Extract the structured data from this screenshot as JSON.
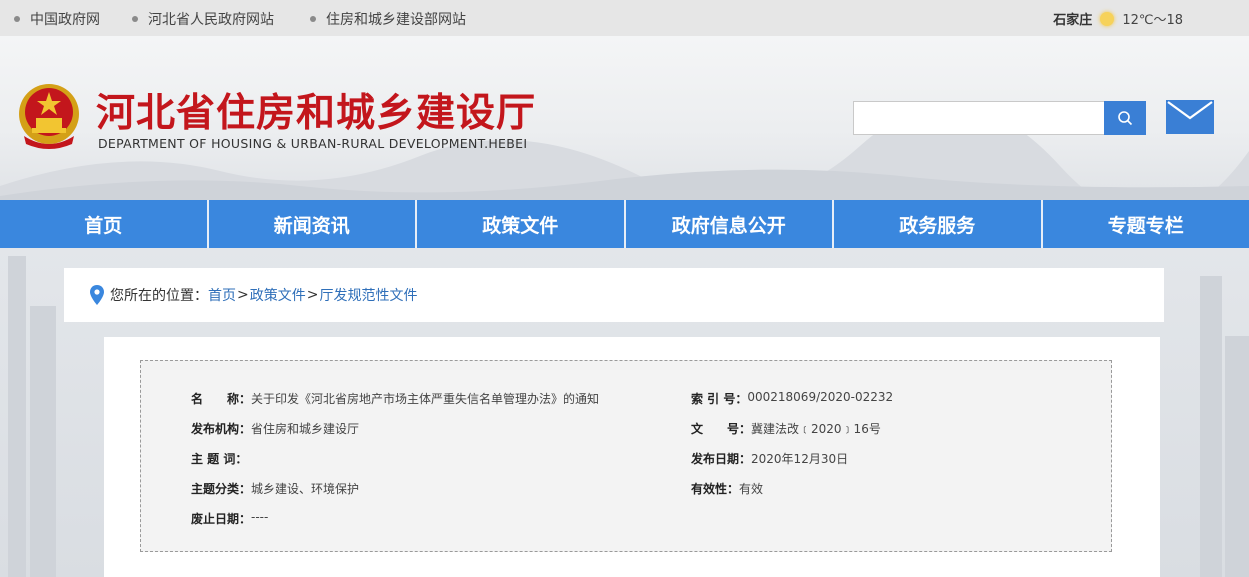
{
  "topbar": {
    "links": [
      "中国政府网",
      "河北省人民政府网站",
      "住房和城乡建设部网站"
    ],
    "weather_city": "石家庄",
    "weather_temp": "12℃～18"
  },
  "header": {
    "title": "河北省住房和城乡建设厅",
    "subtitle": "DEPARTMENT OF HOUSING & URBAN-RURAL DEVELOPMENT.HEBEI",
    "search_placeholder": ""
  },
  "nav": {
    "items": [
      "首页",
      "新闻资讯",
      "政策文件",
      "政府信息公开",
      "政务服务",
      "专题专栏"
    ]
  },
  "breadcrumb": {
    "label": "您所在的位置：",
    "items": [
      "首页",
      "政策文件",
      "厅发规范性文件"
    ],
    "separator": ">"
  },
  "meta": {
    "name_k": "名　　称：",
    "name_v": "关于印发《河北省房地产市场主体严重失信名单管理办法》的通知",
    "publisher_k": "发布机构：",
    "publisher_v": "省住房和城乡建设厅",
    "subject_k": "主 题 词：",
    "subject_v": "",
    "category_k": "主题分类：",
    "category_v": "城乡建设、环境保护",
    "repeal_k": "废止日期：",
    "repeal_v": "----",
    "index_k": "索 引 号：",
    "index_v": "000218069/2020-02232",
    "docno_k": "文　　号：",
    "docno_v": "冀建法改﹝2020﹞16号",
    "date_k": "发布日期：",
    "date_v": "2020年12月30日",
    "valid_k": "有效性：",
    "valid_v": "有效"
  },
  "colors": {
    "brand_red": "#c3161c",
    "nav_blue": "#3a87de",
    "link_blue": "#2f6fb9"
  }
}
